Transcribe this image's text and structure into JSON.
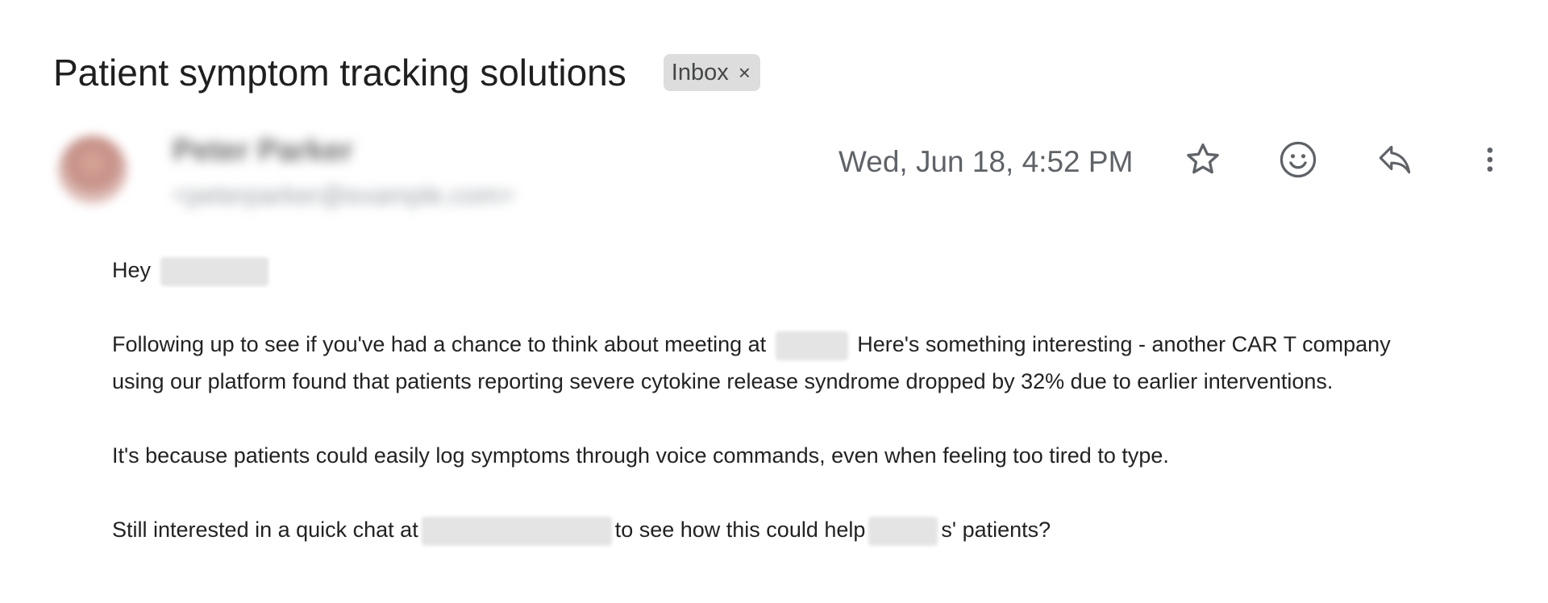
{
  "email": {
    "subject": "Patient symptom tracking solutions",
    "label": "Inbox",
    "label_remove": "×",
    "date": "Wed, Jun 18, 4:52 PM",
    "body": {
      "greeting": "Hey",
      "p1_a": "Following up to see if you've had a chance to think about meeting at",
      "p1_b": "Here's something interesting - another CAR T company using our platform found that patients reporting severe cytokine release syndrome dropped by 32% due to earlier interventions.",
      "p2": "It's because patients could easily log symptoms through voice commands, even when feeling too tired to type.",
      "p3_a": "Still interested in a quick chat at",
      "p3_b": "to see how this could help",
      "p3_c": "s' patients?"
    }
  },
  "icons": {
    "star": "star-icon",
    "emoji": "emoji-icon",
    "reply": "reply-icon",
    "more": "more-vert-icon"
  }
}
